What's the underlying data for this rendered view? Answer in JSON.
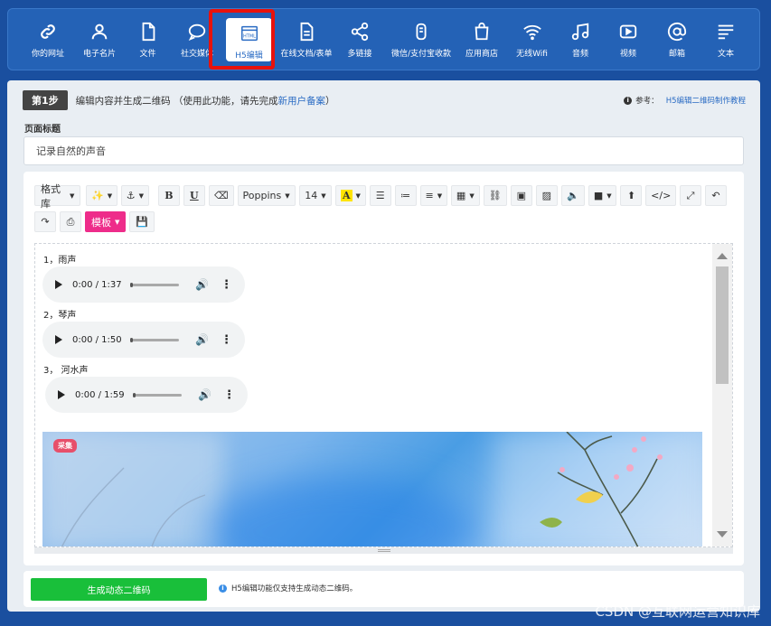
{
  "nav": [
    {
      "label": "你的网址",
      "icon": "link-icon"
    },
    {
      "label": "电子名片",
      "icon": "user-icon"
    },
    {
      "label": "文件",
      "icon": "file-icon"
    },
    {
      "label": "社交媒体",
      "icon": "chat-icon"
    },
    {
      "label": "H5编辑",
      "icon": "html-icon",
      "active": true
    },
    {
      "label": "在线文档/表单",
      "icon": "document-icon"
    },
    {
      "label": "多链接",
      "icon": "share-icon"
    },
    {
      "label": "微信/支付宝收款",
      "icon": "wallet-icon"
    },
    {
      "label": "应用商店",
      "icon": "store-icon"
    },
    {
      "label": "无线Wifi",
      "icon": "wifi-icon"
    },
    {
      "label": "音频",
      "icon": "music-icon"
    },
    {
      "label": "视频",
      "icon": "video-icon"
    },
    {
      "label": "邮箱",
      "icon": "at-icon"
    },
    {
      "label": "文本",
      "icon": "text-icon"
    }
  ],
  "step": {
    "badge": "第1步",
    "text": "编辑内容并生成二维码 （使用此功能，请先完成",
    "link": "新用户备案",
    "text_end": "）"
  },
  "help": {
    "prefix": "参考：",
    "link": "H5编辑二维码制作教程"
  },
  "page_title": {
    "label": "页面标题",
    "value": "记录自然的声音"
  },
  "toolbar": {
    "style_lib": "格式库",
    "font": "Poppins",
    "size": "14",
    "bold": "B",
    "underline": "U",
    "highlight": "A",
    "template": "模板"
  },
  "audios": [
    {
      "label": "1，雨声",
      "time": "0:00 / 1:37"
    },
    {
      "label": "2，琴声",
      "time": "0:00 / 1:50"
    },
    {
      "label": "3， 河水声",
      "time": "0:00 / 1:59"
    }
  ],
  "photo_tag": "采集",
  "generate_button": "生成动态二维码",
  "note": "H5编辑功能仅支持生成动态二维码。",
  "watermark": "CSDN @互联网运营知识库"
}
